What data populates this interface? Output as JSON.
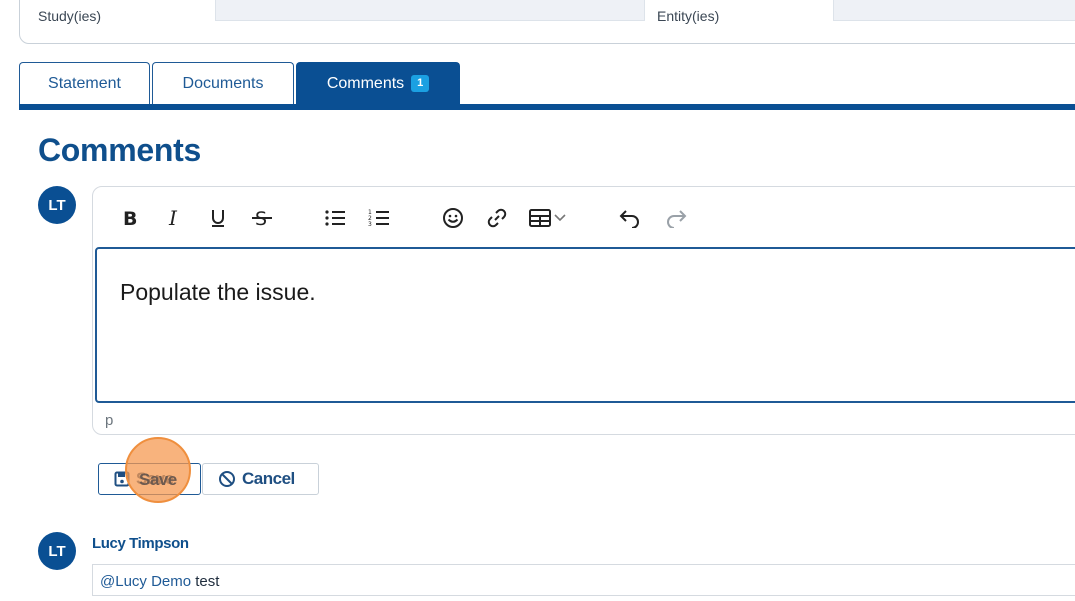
{
  "filters": {
    "study_label": "Study(ies)",
    "entity_label": "Entity(ies)"
  },
  "tabs": [
    {
      "label": "Statement",
      "active": false
    },
    {
      "label": "Documents",
      "active": false
    },
    {
      "label": "Comments",
      "active": true,
      "badge": "1"
    }
  ],
  "page_title": "Comments",
  "current_user_initials": "LT",
  "editor": {
    "toolbar_icons": [
      "bold-icon",
      "italic-icon",
      "underline-icon",
      "strikethrough-icon",
      "bullet-list-icon",
      "numbered-list-icon",
      "emoji-icon",
      "link-icon",
      "table-icon",
      "chevron-down-icon",
      "undo-icon",
      "redo-icon"
    ],
    "content": "Populate the issue.",
    "status_path": "p"
  },
  "actions": {
    "save_label": "Save",
    "cancel_label": "Cancel"
  },
  "comments": [
    {
      "initials": "LT",
      "author": "Lucy Timpson",
      "mention": "@Lucy Demo",
      "text": " test"
    }
  ],
  "colors": {
    "primary": "#0a4f93",
    "accent_badge": "#1ba0e2",
    "click_marker": "#f59a52"
  }
}
